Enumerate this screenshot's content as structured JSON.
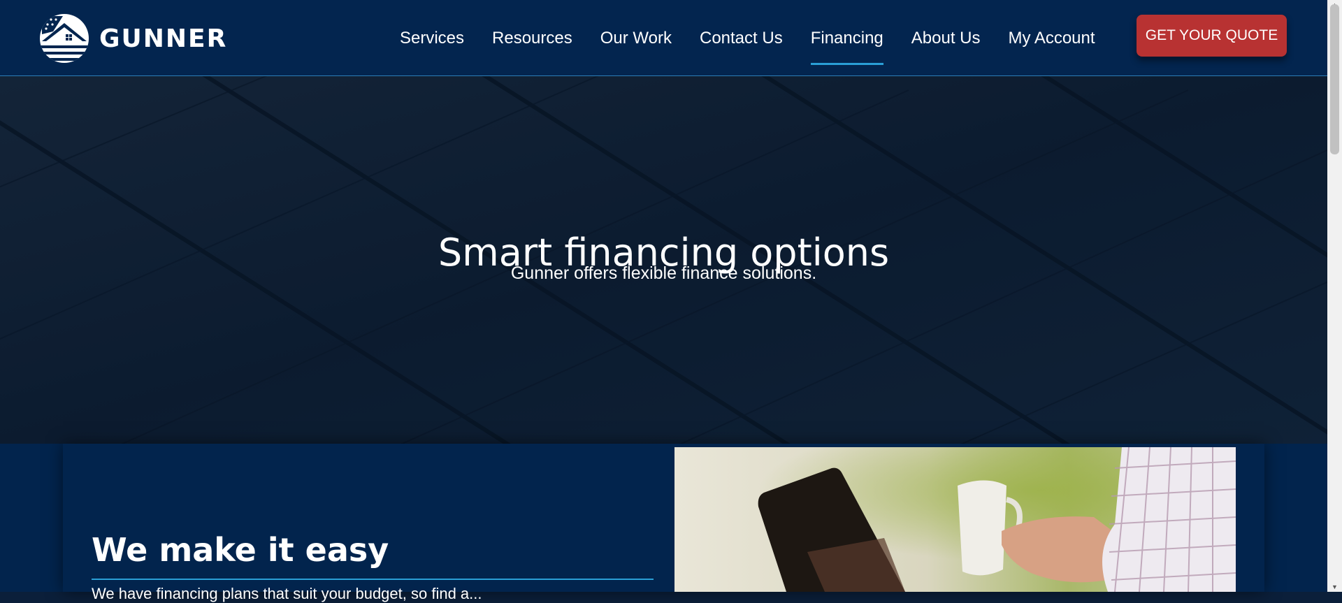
{
  "brand": {
    "name": "GUNNER"
  },
  "nav": {
    "items": [
      {
        "label": "Services"
      },
      {
        "label": "Resources"
      },
      {
        "label": "Our Work"
      },
      {
        "label": "Contact Us"
      },
      {
        "label": "Financing",
        "active": true
      },
      {
        "label": "About Us"
      },
      {
        "label": "My Account"
      }
    ],
    "cta_label": "GET YOUR QUOTE"
  },
  "hero": {
    "title": "Smart financing options",
    "subtitle": "Gunner offers flexible finance solutions."
  },
  "section": {
    "title": "We make it easy",
    "body_partial": "We have financing plans that suit your budget, so find a..."
  },
  "colors": {
    "header_bg": "#03254f",
    "accent_blue": "#2a9fd6",
    "cta_red": "#b83232",
    "hero_bg": "#0d1c30"
  }
}
